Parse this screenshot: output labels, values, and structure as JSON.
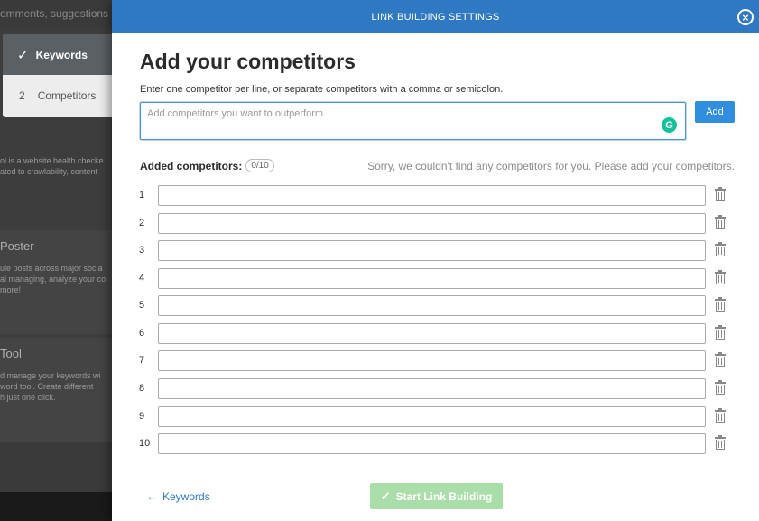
{
  "background": {
    "top_text": "omments, suggestions an",
    "steps": [
      {
        "number": "✓",
        "label": "Keywords",
        "active": true
      },
      {
        "number": "2",
        "label": "Competitors",
        "active": false
      }
    ],
    "cards": [
      {
        "title": "",
        "lines": [
          "ol is a website health checke",
          "ated to crawlability, content"
        ]
      },
      {
        "title": "Poster",
        "lines": [
          "ule posts across major socia",
          "al managing, analyze your co",
          "more!"
        ]
      },
      {
        "title": "Tool",
        "lines": [
          "d manage your keywords wi",
          "word tool. Create different",
          "h just one click."
        ]
      }
    ]
  },
  "modal": {
    "header_title": "LINK BUILDING SETTINGS",
    "close_symbol": "×",
    "title": "Add your competitors",
    "instructions": "Enter one competitor per line, or separate competitors with a comma or semicolon.",
    "input_placeholder": "Add competitors you want to outperform",
    "add_label": "Add",
    "added_label": "Added competitors:",
    "count": "0/10",
    "sorry_message": "Sorry, we couldn't find any competitors for you. Please add your competitors.",
    "rows": [
      "1",
      "2",
      "3",
      "4",
      "5",
      "6",
      "7",
      "8",
      "9",
      "10"
    ],
    "back_label": "Keywords",
    "start_label": "Start Link Building"
  },
  "colors": {
    "header": "#2f78c2",
    "add_button": "#2f8ee0",
    "start_button_disabled": "#a9dea9",
    "grammarly": "#15c39a"
  }
}
